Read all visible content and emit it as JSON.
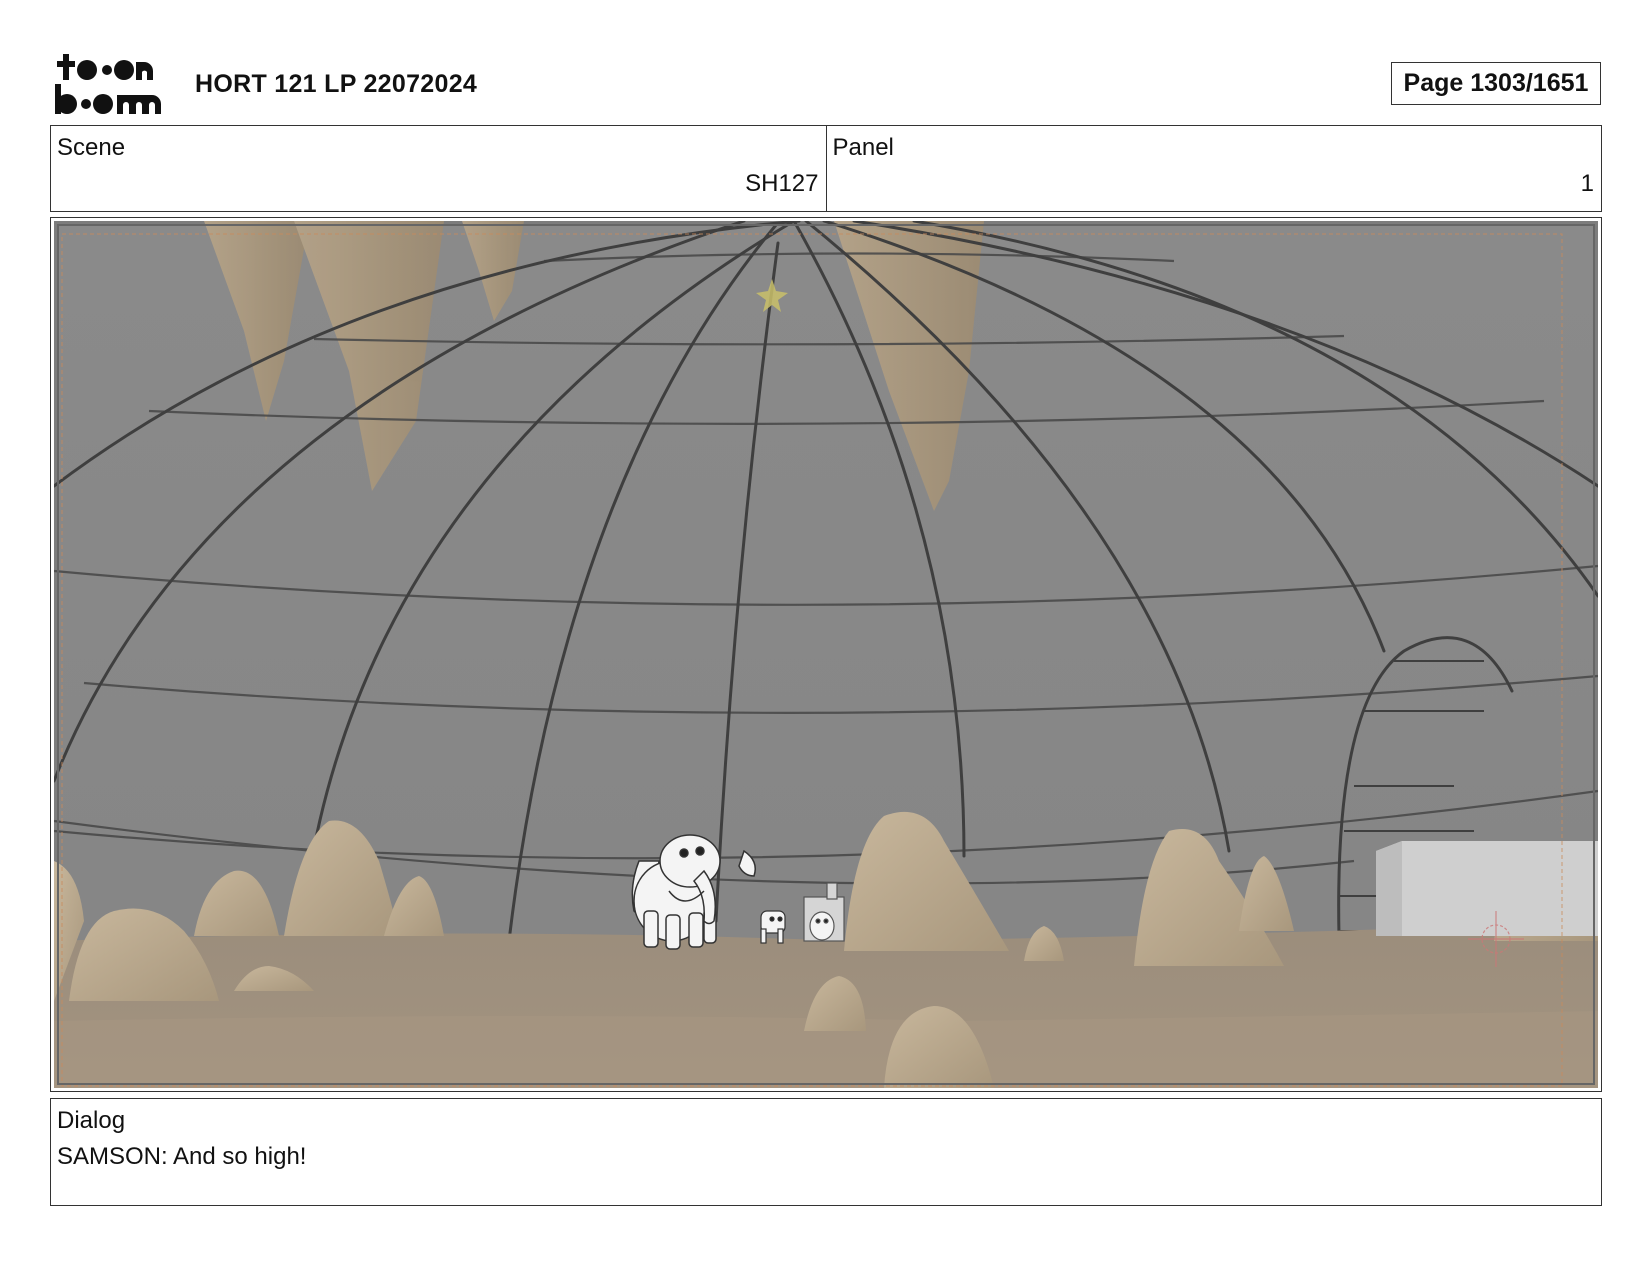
{
  "header": {
    "logo_text": "toon boom",
    "title": "HORT 121 LP 22072024",
    "page": "Page 1303/1651"
  },
  "scene": {
    "label": "Scene",
    "value": "SH127"
  },
  "panel": {
    "label": "Panel",
    "value": "1"
  },
  "dialog": {
    "label": "Dialog",
    "text": "SAMSON: And so high!"
  }
}
